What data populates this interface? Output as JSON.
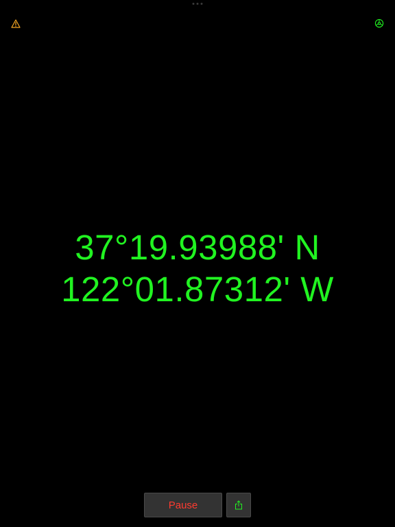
{
  "header": {
    "warning_icon": "warning-triangle-icon",
    "settings_icon": "gear-icon"
  },
  "coordinates": {
    "latitude": "37°19.93988' N",
    "longitude": "122°01.87312' W"
  },
  "toolbar": {
    "pause_label": "Pause",
    "share_icon": "share-icon"
  },
  "colors": {
    "background": "#000000",
    "coordinate_text": "#21f321",
    "warning": "#f5a623",
    "settings": "#21f321",
    "pause_text": "#ff3b30",
    "button_bg": "#333333"
  }
}
